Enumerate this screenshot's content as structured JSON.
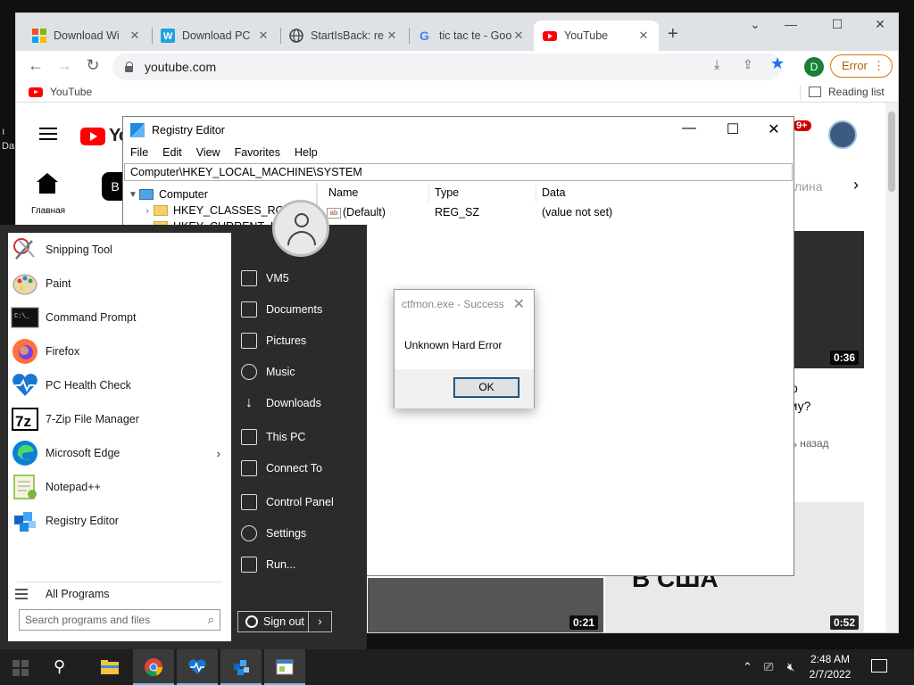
{
  "desktop": {
    "label": "Da",
    "mark": "ı"
  },
  "browser": {
    "tabs": [
      {
        "title": "Download Wi",
        "icon": "windows-logo-icon"
      },
      {
        "title": "Download PC",
        "icon": "w-logo-icon"
      },
      {
        "title": "StartIsBack: re",
        "icon": "globe-icon"
      },
      {
        "title": "tic tac te - Goo",
        "icon": "google-g-icon"
      },
      {
        "title": "YouTube",
        "icon": "youtube-icon"
      }
    ],
    "new_tab": "+",
    "url": "youtube.com",
    "profile_initial": "D",
    "error_label": "Error",
    "bookmarks": [
      {
        "label": "YouTube"
      }
    ],
    "reading_list": "Reading list",
    "colors": {
      "tabstrip": "#dee1e6",
      "accent": "#1a73e8",
      "error": "#e37400"
    }
  },
  "youtube": {
    "logo_text": "Yo",
    "home_label": "Главная",
    "chip_first": "В",
    "chip_last": "лина",
    "notifications": "9+",
    "videos": [
      {
        "duration": "0:36"
      },
      {
        "duration": "0:21"
      },
      {
        "duration": "0:52",
        "overlay_text": "В США"
      }
    ],
    "side_title_1": "о",
    "side_title_2": "ему?",
    "side_meta": "нь назад"
  },
  "regedit": {
    "title": "Registry Editor",
    "menu": [
      "File",
      "Edit",
      "View",
      "Favorites",
      "Help"
    ],
    "address": "Computer\\HKEY_LOCAL_MACHINE\\SYSTEM",
    "tree": [
      {
        "label": "Computer",
        "expanded": true
      },
      {
        "label": "HKEY_CLASSES_ROOT"
      },
      {
        "label": "HKEY_CURRENT_USER"
      }
    ],
    "columns": [
      "Name",
      "Type",
      "Data"
    ],
    "values": [
      {
        "name": "(Default)",
        "type": "REG_SZ",
        "data": "(value not set)"
      }
    ]
  },
  "dialog": {
    "title": "ctfmon.exe - Success",
    "message": "Unknown Hard Error",
    "ok": "OK"
  },
  "start_menu": {
    "apps": [
      {
        "label": "Snipping Tool",
        "icon": "snipping-tool-icon"
      },
      {
        "label": "Paint",
        "icon": "paint-icon"
      },
      {
        "label": "Command Prompt",
        "icon": "cmd-icon"
      },
      {
        "label": "Firefox",
        "icon": "firefox-icon"
      },
      {
        "label": "PC Health Check",
        "icon": "pc-health-icon"
      },
      {
        "label": "7-Zip File Manager",
        "icon": "7zip-icon"
      },
      {
        "label": "Microsoft Edge",
        "icon": "edge-icon",
        "has_submenu": true
      },
      {
        "label": "Notepad++",
        "icon": "notepadpp-icon"
      },
      {
        "label": "Registry Editor",
        "icon": "regedit-icon"
      }
    ],
    "all_programs": "All Programs",
    "search_placeholder": "Search programs and files",
    "right_items": [
      {
        "label": "VM5",
        "icon": "user-folder-icon"
      },
      {
        "label": "Documents",
        "icon": "documents-icon"
      },
      {
        "label": "Pictures",
        "icon": "pictures-icon"
      },
      {
        "label": "Music",
        "icon": "music-icon"
      },
      {
        "label": "Downloads",
        "icon": "downloads-icon"
      },
      {
        "label": "This PC",
        "icon": "this-pc-icon"
      },
      {
        "label": "Connect To",
        "icon": "connect-icon"
      },
      {
        "label": "Control Panel",
        "icon": "control-panel-icon"
      },
      {
        "label": "Settings",
        "icon": "settings-icon"
      },
      {
        "label": "Run...",
        "icon": "run-icon"
      }
    ],
    "sign_out": "Sign out"
  },
  "taskbar": {
    "apps": [
      {
        "icon": "file-explorer-icon"
      },
      {
        "icon": "chrome-icon"
      },
      {
        "icon": "pc-health-icon"
      },
      {
        "icon": "regedit-icon"
      },
      {
        "icon": "app-window-icon"
      }
    ],
    "time": "2:48 AM",
    "date": "2/7/2022"
  }
}
